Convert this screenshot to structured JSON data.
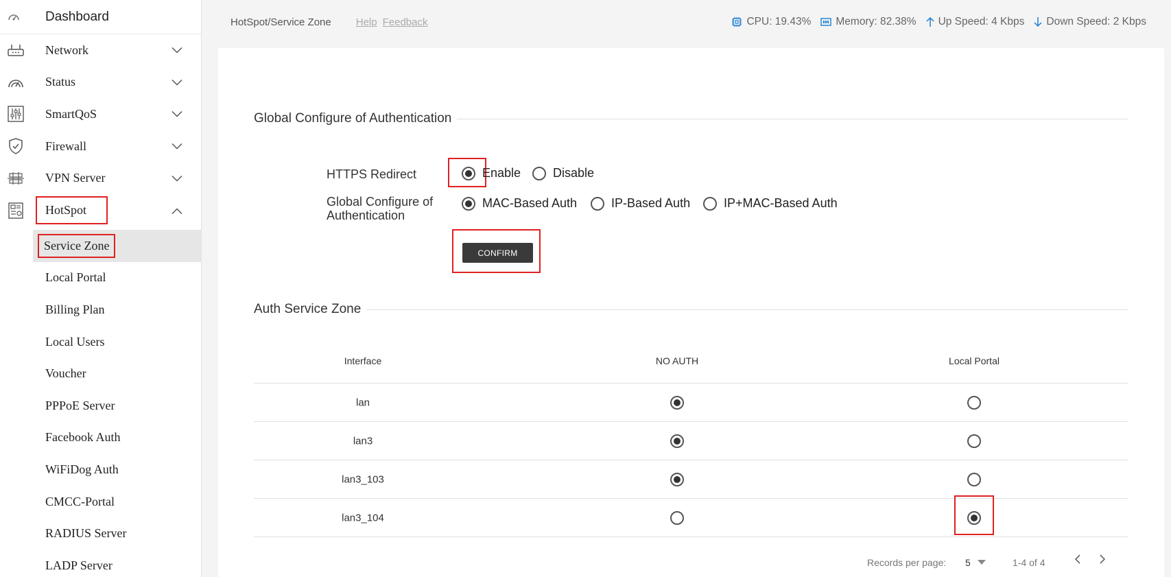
{
  "sidebar": {
    "dashboard": {
      "label": "Dashboard",
      "icon": "dashboard-icon"
    },
    "menu": [
      {
        "label": "Network",
        "icon": "router-icon",
        "expanded": false
      },
      {
        "label": "Status",
        "icon": "gauge-icon",
        "expanded": false
      },
      {
        "label": "SmartQoS",
        "icon": "sliders-icon",
        "expanded": false
      },
      {
        "label": "Firewall",
        "icon": "shield-icon",
        "expanded": false
      },
      {
        "label": "VPN Server",
        "icon": "vpn-icon",
        "expanded": false
      },
      {
        "label": "HotSpot",
        "icon": "hotspot-icon",
        "expanded": true
      }
    ],
    "submenu": [
      {
        "label": "Service Zone",
        "active": true
      },
      {
        "label": "Local Portal"
      },
      {
        "label": "Billing Plan"
      },
      {
        "label": "Local Users"
      },
      {
        "label": "Voucher"
      },
      {
        "label": "PPPoE Server"
      },
      {
        "label": "Facebook Auth"
      },
      {
        "label": "WiFiDog Auth"
      },
      {
        "label": "CMCC-Portal"
      },
      {
        "label": "RADIUS Server"
      },
      {
        "label": "LADP Server"
      }
    ]
  },
  "topbar": {
    "breadcrumb": "HotSpot/Service Zone",
    "help": "Help",
    "feedback": "Feedback",
    "cpu": "CPU: 19.43%",
    "memory": "Memory: 82.38%",
    "up": "Up Speed: 4 Kbps",
    "down": "Down Speed: 2 Kbps",
    "accent": "#1a7fd4"
  },
  "global": {
    "title": "Global Configure of Authentication",
    "https_label": "HTTPS Redirect",
    "https_options": [
      {
        "label": "Enable",
        "checked": true
      },
      {
        "label": "Disable",
        "checked": false
      }
    ],
    "auth_label_1": "Global Configure of",
    "auth_label_2": "Authentication",
    "auth_options": [
      {
        "label": "MAC-Based Auth",
        "checked": true
      },
      {
        "label": "IP-Based Auth",
        "checked": false
      },
      {
        "label": "IP+MAC-Based Auth",
        "checked": false
      }
    ],
    "confirm": "CONFIRM"
  },
  "zone": {
    "title": "Auth Service Zone",
    "columns": [
      "Interface",
      "NO AUTH",
      "Local Portal"
    ],
    "rows": [
      {
        "interface": "lan",
        "mode": "NO AUTH"
      },
      {
        "interface": "lan3",
        "mode": "NO AUTH"
      },
      {
        "interface": "lan3_103",
        "mode": "NO AUTH"
      },
      {
        "interface": "lan3_104",
        "mode": "Local Portal"
      }
    ],
    "records_label": "Records per page:",
    "records_value": "5",
    "range": "1-4 of 4"
  }
}
